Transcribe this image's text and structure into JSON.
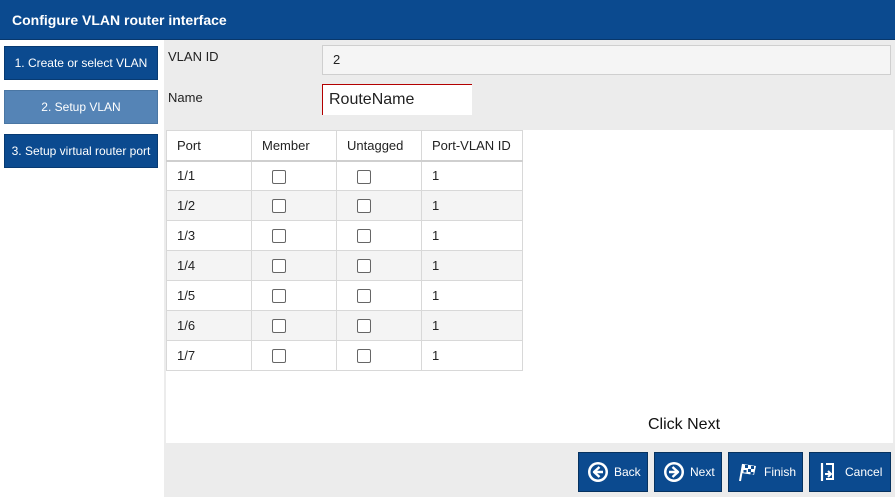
{
  "window": {
    "title": "Configure VLAN router interface"
  },
  "steps": [
    {
      "label": "1. Create or select VLAN"
    },
    {
      "label": "2. Setup VLAN"
    },
    {
      "label": "3. Setup virtual router port"
    }
  ],
  "form": {
    "vlan_id_label": "VLAN ID",
    "vlan_id_value": "2",
    "name_label": "Name",
    "name_value": "RouteName"
  },
  "table": {
    "headers": [
      "Port",
      "Member",
      "Untagged",
      "Port-VLAN ID"
    ],
    "rows": [
      {
        "port": "1/1",
        "member": false,
        "untagged": false,
        "pvid": "1"
      },
      {
        "port": "1/2",
        "member": false,
        "untagged": false,
        "pvid": "1"
      },
      {
        "port": "1/3",
        "member": false,
        "untagged": false,
        "pvid": "1"
      },
      {
        "port": "1/4",
        "member": false,
        "untagged": false,
        "pvid": "1"
      },
      {
        "port": "1/5",
        "member": false,
        "untagged": false,
        "pvid": "1"
      },
      {
        "port": "1/6",
        "member": false,
        "untagged": false,
        "pvid": "1"
      },
      {
        "port": "1/7",
        "member": false,
        "untagged": false,
        "pvid": "1"
      }
    ]
  },
  "hint": "Click Next",
  "buttons": {
    "back": "Back",
    "next": "Next",
    "finish": "Finish",
    "cancel": "Cancel"
  },
  "icons": {
    "back": "back-arrow-icon",
    "next": "next-arrow-icon",
    "finish": "checkered-flag-icon",
    "cancel": "cancel-exit-icon"
  },
  "colors": {
    "primary": "#0b4a8f",
    "active_step": "#5584b6",
    "content_bg": "#ececec",
    "name_border": "#b30000"
  }
}
